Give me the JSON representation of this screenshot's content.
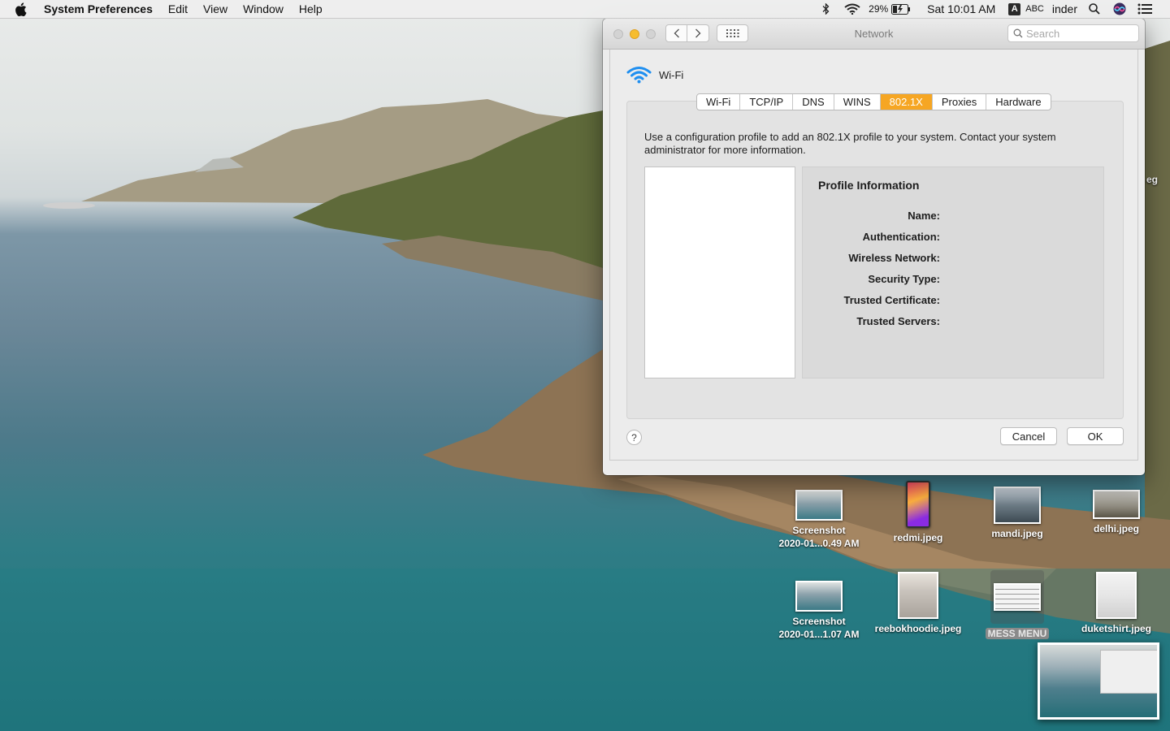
{
  "menubar": {
    "apple_icon": "apple-logo-icon",
    "app_name": "System Preferences",
    "menus": [
      "Edit",
      "View",
      "Window",
      "Help"
    ],
    "battery_percent": "29%",
    "clock": "Sat 10:01 AM",
    "input_source_letter": "A",
    "input_source_label": "ABC",
    "user": "inder",
    "icons": [
      "bluetooth-icon",
      "wifi-icon",
      "battery-charging-icon",
      "spotlight-search-icon",
      "siri-icon",
      "notification-center-icon"
    ]
  },
  "window": {
    "title": "Network",
    "search_placeholder": "Search",
    "interface_name": "Wi-Fi",
    "tabs": [
      "Wi-Fi",
      "TCP/IP",
      "DNS",
      "WINS",
      "802.1X",
      "Proxies",
      "Hardware"
    ],
    "active_tab": "802.1X",
    "description": "Use a configuration profile to add an 802.1X profile to your system. Contact your system administrator for more information.",
    "profile_info": {
      "title": "Profile Information",
      "fields": [
        "Name:",
        "Authentication:",
        "Wireless Network:",
        "Security Type:",
        "Trusted Certificate:",
        "Trusted Servers:"
      ]
    },
    "help_label": "?",
    "cancel_label": "Cancel",
    "ok_label": "OK",
    "accent_color": "#f6a623"
  },
  "desktop": {
    "icons": [
      {
        "line1": "Screenshot",
        "line2": "2020-01...0.49 AM"
      },
      {
        "line1": "redmi.jpeg",
        "line2": ""
      },
      {
        "line1": "mandi.jpeg",
        "line2": ""
      },
      {
        "line1": "delhi.jpeg",
        "line2": ""
      },
      {
        "line1": "Screenshot",
        "line2": "2020-01...1.07 AM"
      },
      {
        "line1": "reebokhoodie.jpeg",
        "line2": ""
      },
      {
        "line1": "MESS MENU",
        "line2": ""
      },
      {
        "line1": "duketshirt.jpeg",
        "line2": ""
      }
    ],
    "edge_partial_text": "eg"
  }
}
